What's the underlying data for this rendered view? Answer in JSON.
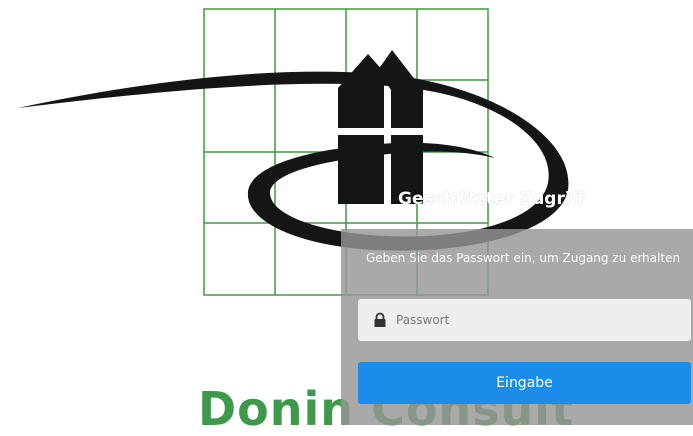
{
  "brand": {
    "logo_icon": "house-grid-swoosh-logo",
    "partial_name": "Donin Consult",
    "green": "#3e9a4a"
  },
  "login": {
    "title": "Geschützter Zugriff",
    "description": "Geben Sie das Passwort ein, um Zugang zu erhalten",
    "password_placeholder": "Passwort",
    "password_icon": "lock-icon",
    "submit_label": "Eingabe",
    "accent": "#1c8cea",
    "panel_color": "#969696"
  }
}
